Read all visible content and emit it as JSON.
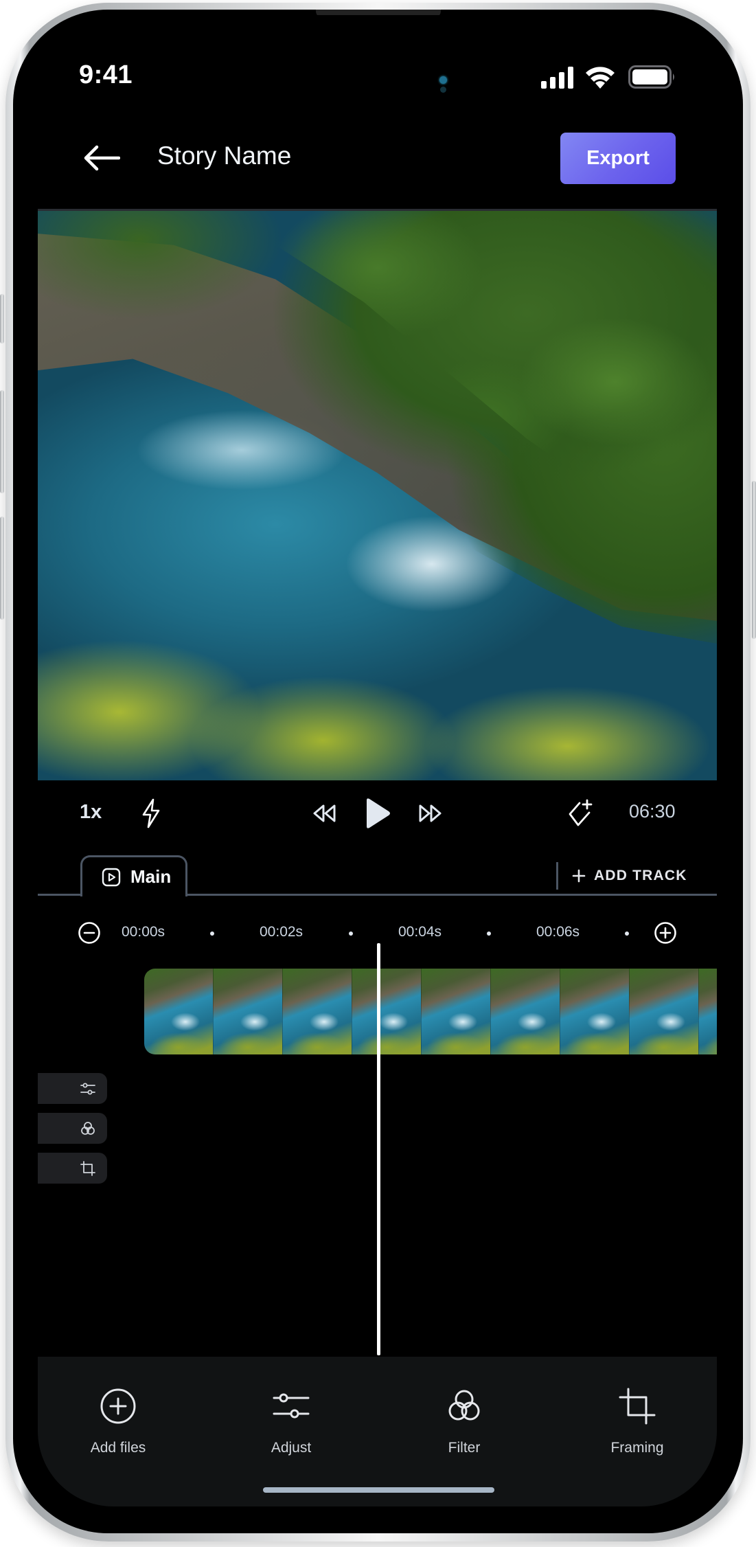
{
  "status_bar": {
    "time": "9:41"
  },
  "header": {
    "back_icon": "arrow-left-icon",
    "title": "Story Name",
    "export_label": "Export"
  },
  "player": {
    "speed": "1x",
    "icons": [
      "lightning-icon",
      "rewind-icon",
      "play-icon",
      "fast-forward-icon",
      "keyframe-add-icon"
    ],
    "duration": "06:30"
  },
  "tracks": {
    "tabs": [
      {
        "label": "Main",
        "icon": "video-icon",
        "active": true
      }
    ],
    "add_track_label": "ADD TRACK"
  },
  "ruler": {
    "zoom_out_icon": "minus-circle-icon",
    "zoom_in_icon": "plus-circle-icon",
    "labels": [
      "00:00s",
      "00:02s",
      "00:04s",
      "00:06s"
    ]
  },
  "side_tools": [
    "adjust-icon",
    "filter-icon",
    "crop-icon"
  ],
  "bottom_toolbar": {
    "items": [
      {
        "label": "Add files",
        "icon": "plus-circle-icon"
      },
      {
        "label": "Adjust",
        "icon": "sliders-icon"
      },
      {
        "label": "Filter",
        "icon": "filter-icon"
      },
      {
        "label": "Framing",
        "icon": "crop-icon"
      }
    ]
  },
  "colors": {
    "accent_start": "#8287f3",
    "accent_end": "#5b4ee8",
    "background": "#000000",
    "toolbar_bg": "#111314",
    "divider": "#4b5563"
  }
}
